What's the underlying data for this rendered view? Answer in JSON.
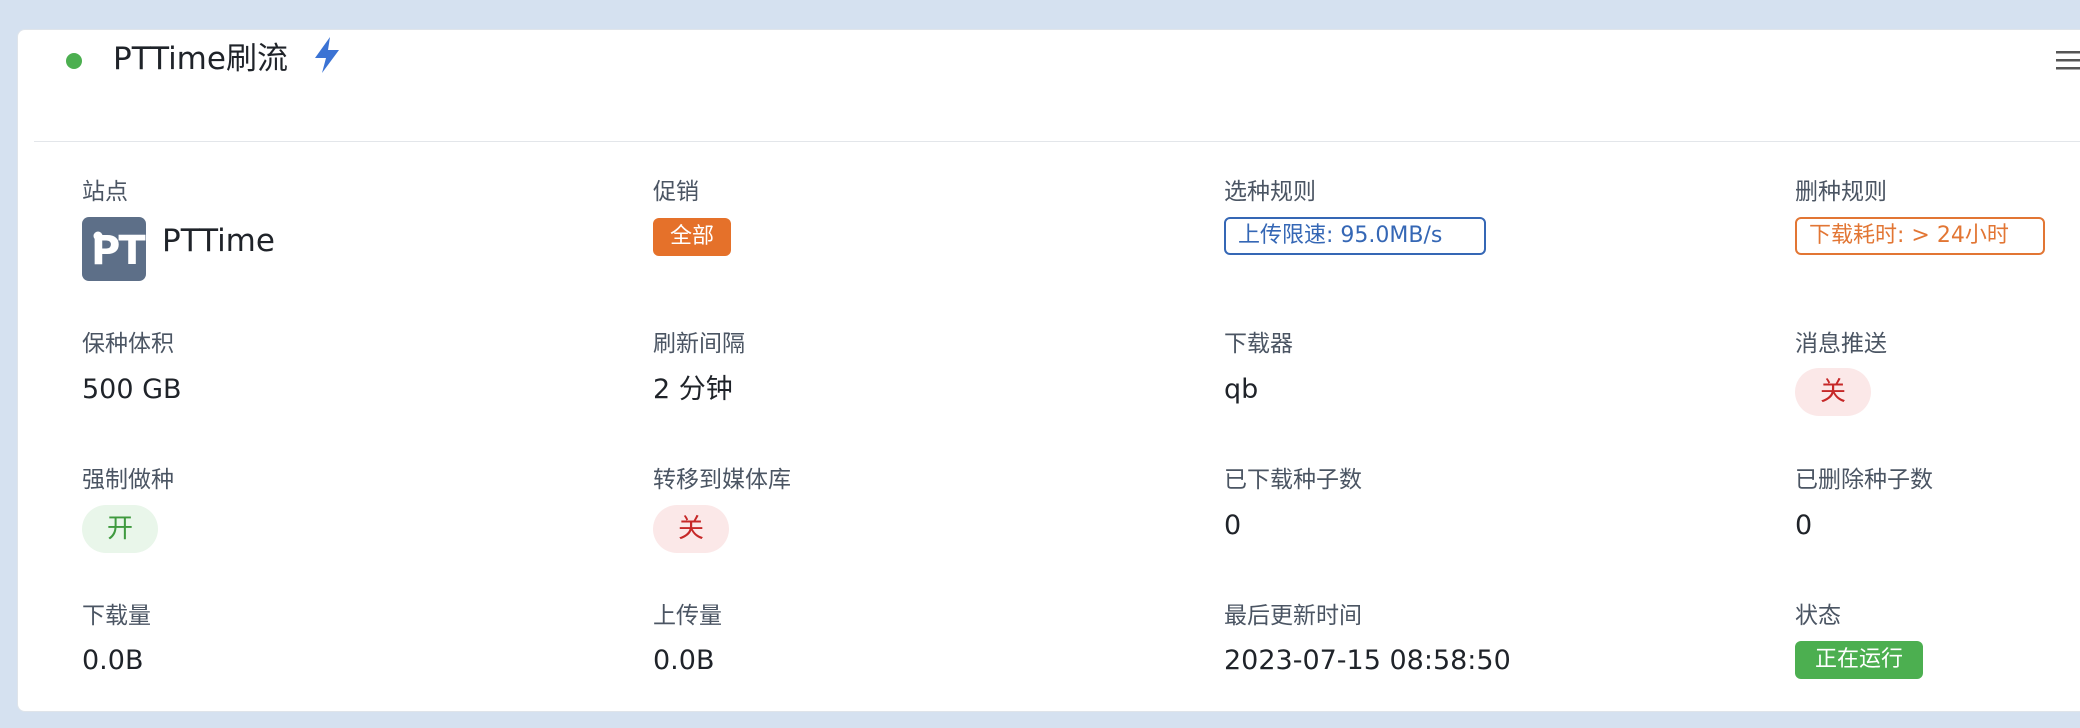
{
  "header": {
    "title": "PTTime刷流",
    "status_icon": "green-dot-icon",
    "bolt_icon": "lightning-icon",
    "menu_icon": "menu-icon",
    "status_color": "#4caf50",
    "bolt_color": "#3b73d4"
  },
  "fields": {
    "site": {
      "label": "站点",
      "name": "PTTime",
      "logo_text": "PT"
    },
    "promo": {
      "label": "促销",
      "value": "全部",
      "color": "#e5712a"
    },
    "select_rule": {
      "label": "选种规则",
      "value": "上传限速: 95.0MB/s",
      "color": "#3567b5"
    },
    "delete_rule": {
      "label": "删种规则",
      "value": "下载耗时: > 24小时",
      "color": "#e27634"
    },
    "seed_size": {
      "label": "保种体积",
      "value": "500 GB"
    },
    "refresh_interval": {
      "label": "刷新间隔",
      "value": "2 分钟"
    },
    "downloader": {
      "label": "下载器",
      "value": "qb"
    },
    "notify": {
      "label": "消息推送",
      "value": "关"
    },
    "force_seed": {
      "label": "强制做种",
      "value": "开"
    },
    "transfer": {
      "label": "转移到媒体库",
      "value": "关"
    },
    "downloaded_count": {
      "label": "已下载种子数",
      "value": "0"
    },
    "deleted_count": {
      "label": "已删除种子数",
      "value": "0"
    },
    "download_amount": {
      "label": "下载量",
      "value": "0.0B"
    },
    "upload_amount": {
      "label": "上传量",
      "value": "0.0B"
    },
    "last_update": {
      "label": "最后更新时间",
      "value": "2023-07-15 08:58:50"
    },
    "state": {
      "label": "状态",
      "value": "正在运行",
      "color": "#4caf50"
    }
  }
}
